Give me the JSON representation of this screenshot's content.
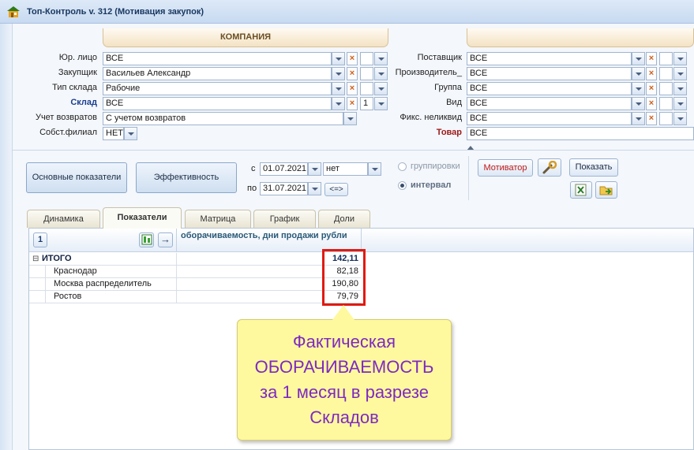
{
  "app": {
    "title": "Топ-Контроль v. 312 (Мотивация закупок)"
  },
  "header": {
    "company_tab": "КОМПАНИЯ",
    "right_tab": ""
  },
  "filters_left": [
    {
      "label": "Юр. лицо",
      "value": "ВСЕ",
      "extra": ""
    },
    {
      "label": "Закупщик",
      "value": "Васильев Александр",
      "extra": ""
    },
    {
      "label": "Тип склада",
      "value": "Рабочие",
      "extra": ""
    },
    {
      "label": "Склад",
      "value": "ВСЕ",
      "extra": "1"
    },
    {
      "label": "Учет возвратов",
      "value": "С учетом возвратов",
      "extra": ""
    },
    {
      "label": "Собст.филиал",
      "value": "НЕТ",
      "extra": ""
    }
  ],
  "filters_right": [
    {
      "label": "Поставщик",
      "value": "ВСЕ"
    },
    {
      "label": "Производитель_",
      "value": "ВСЕ"
    },
    {
      "label": "Группа",
      "value": "ВСЕ"
    },
    {
      "label": "Вид",
      "value": "ВСЕ"
    },
    {
      "label": "Фикс. неликвид",
      "value": "ВСЕ"
    },
    {
      "label": "Товар",
      "value": "ВСЕ"
    }
  ],
  "actions": {
    "main_indicators": "Основные показатели",
    "efficiency": "Эффективность",
    "from_label": "с",
    "from_date": "01.07.2021",
    "period_value": "нет",
    "to_label": "по",
    "to_date": "31.07.2021",
    "shift_btn": "<=>",
    "radio_grouping": "группировки",
    "radio_interval": "интервал",
    "motivator": "Мотиватор",
    "show": "Показать"
  },
  "tabs": [
    "Динамика",
    "Показатели",
    "Матрица",
    "График",
    "Доли"
  ],
  "grid": {
    "level": "1",
    "arrow": "→",
    "column_header": "оборачиваемость, дни продажи рубли",
    "rows": [
      {
        "name": "ИТОГО",
        "value": "142,11"
      },
      {
        "name": "Краснодар",
        "value": "82,18"
      },
      {
        "name": "Москва распределитель",
        "value": "190,80"
      },
      {
        "name": "Ростов",
        "value": "79,79"
      }
    ],
    "collapse": "⊟"
  },
  "callout": {
    "lines": [
      "Фактическая",
      "ОБОРАЧИВАЕМОСТЬ",
      "за 1 месяц в разрезе",
      "Складов"
    ]
  },
  "colors": {
    "callout_text": "#7d2ac3",
    "highlight": "#e01a12",
    "motivator": "#c01818"
  }
}
